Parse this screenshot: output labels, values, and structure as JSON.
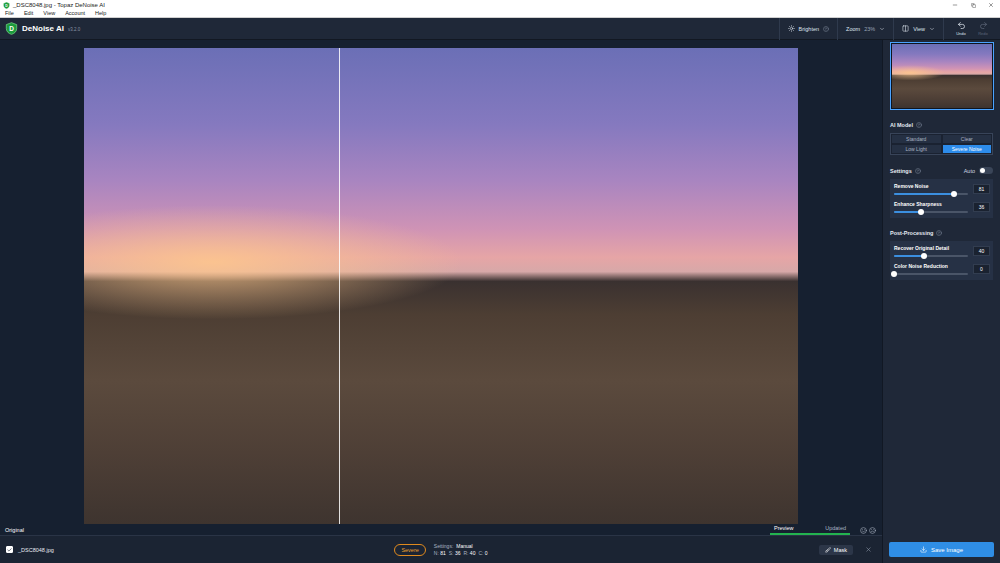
{
  "window": {
    "title": "_DSC8048.jpg - Topaz DeNoise AI"
  },
  "menu": [
    "File",
    "Edit",
    "View",
    "Account",
    "Help"
  ],
  "app": {
    "logo": "D",
    "name": "DeNoise AI",
    "version": "v3.2.0"
  },
  "toolbar": {
    "brighten": {
      "label": "Brighten"
    },
    "zoom": {
      "label": "Zoom",
      "value": "23%"
    },
    "view": {
      "label": "View"
    },
    "undo": {
      "label": "Undo",
      "disabled": false
    },
    "redo": {
      "label": "Redo",
      "disabled": true
    }
  },
  "canvas": {
    "left_label": "Original",
    "compare_divider": {
      "level": 0.357
    },
    "preview": {
      "label": "Preview",
      "level": 1
    },
    "status": "Updated"
  },
  "sidebar": {
    "ai_model": {
      "label": "AI Model",
      "models": [
        {
          "label": "Standard",
          "selected": false
        },
        {
          "label": "Clear",
          "selected": false
        },
        {
          "label": "Low Light",
          "selected": false
        },
        {
          "label": "Severe Noise",
          "selected": true
        }
      ]
    },
    "settings": {
      "label": "Settings",
      "auto": {
        "label": "Auto",
        "on": false
      },
      "sliders": [
        {
          "label": "Remove Noise",
          "value": "81",
          "level": 0.81
        },
        {
          "label": "Enhance Sharpness",
          "value": "36",
          "level": 0.36
        }
      ]
    },
    "post_processing": {
      "label": "Post-Processing",
      "sliders": [
        {
          "label": "Recover Original Detail",
          "value": "40",
          "level": 0.4
        },
        {
          "label": "Color Noise Reduction",
          "value": "0",
          "level": 0
        }
      ]
    }
  },
  "file_bar": {
    "file": {
      "name": "_DSC8048.jpg",
      "checked": true
    },
    "model_badge": "Severe",
    "settings_label": "Settings:",
    "settings_value": "Manual",
    "summary": [
      {
        "key": "N:",
        "value": "81"
      },
      {
        "key": "S:",
        "value": "36"
      },
      {
        "key": "R:",
        "value": "40"
      },
      {
        "key": "C:",
        "value": "0"
      }
    ],
    "mask": {
      "label": "Mask"
    }
  },
  "save_button": {
    "label": "Save Image"
  }
}
